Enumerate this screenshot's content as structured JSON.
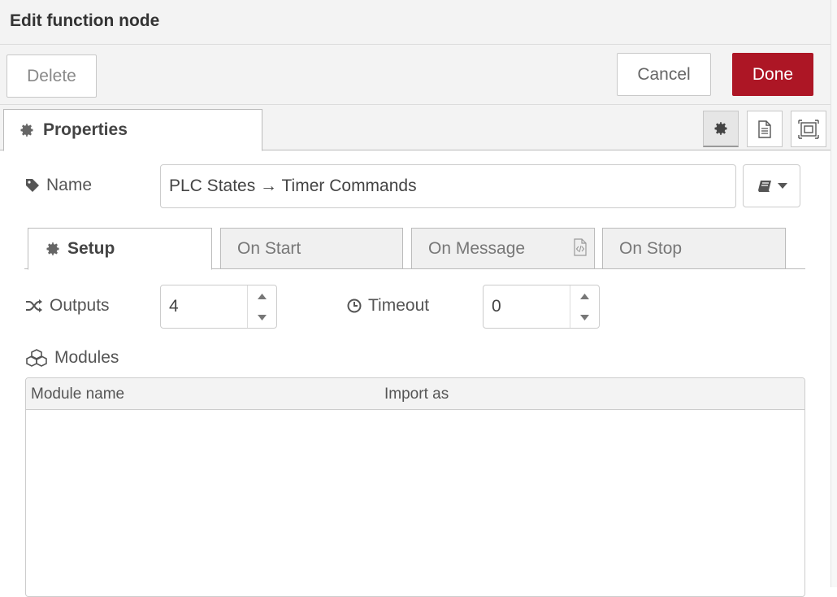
{
  "dialog": {
    "title": "Edit function node"
  },
  "toolbar": {
    "delete_label": "Delete",
    "cancel_label": "Cancel",
    "done_label": "Done",
    "done_color": "#ad1625"
  },
  "tabs": {
    "properties_label": "Properties",
    "icons": [
      "gear-icon",
      "description-icon",
      "appearance-icon"
    ]
  },
  "name": {
    "label": "Name",
    "value": "PLC States → Timer Commands"
  },
  "subtabs": [
    {
      "label": "Setup",
      "active": true
    },
    {
      "label": "On Start",
      "active": false
    },
    {
      "label": "On Message",
      "active": false
    },
    {
      "label": "On Stop",
      "active": false
    }
  ],
  "outputs": {
    "label": "Outputs",
    "value": "4"
  },
  "timeout": {
    "label": "Timeout",
    "value": "0"
  },
  "modules": {
    "label": "Modules",
    "columns": [
      "Module name",
      "Import as"
    ]
  }
}
